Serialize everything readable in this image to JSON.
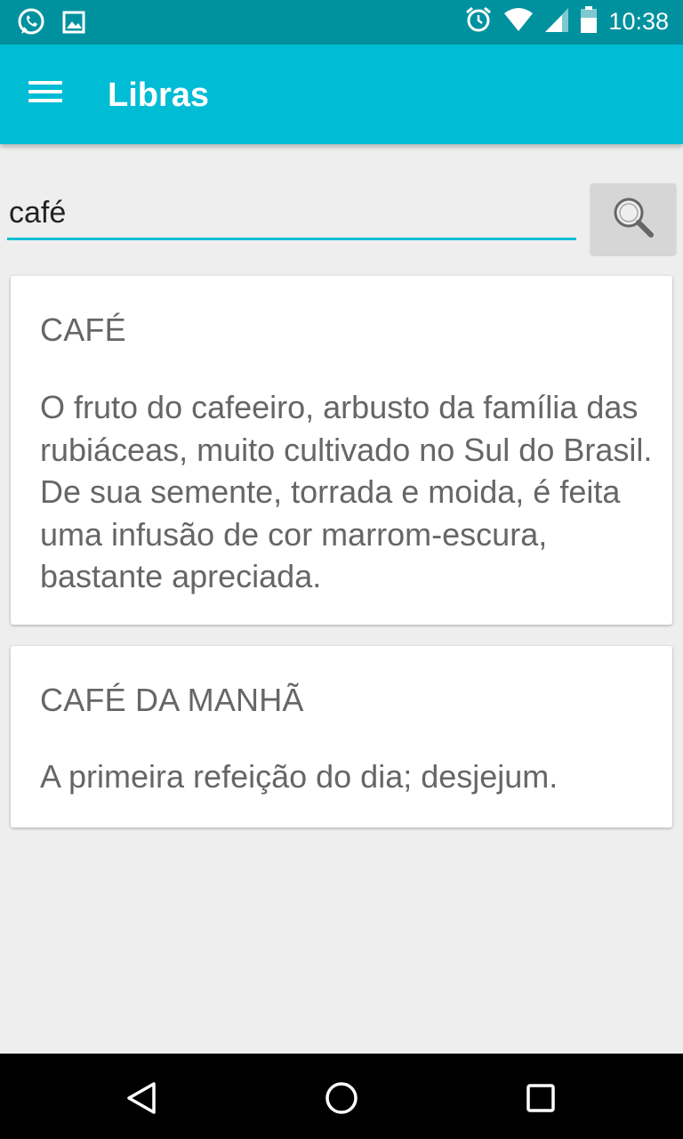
{
  "status_bar": {
    "time": "10:38",
    "left_icons": [
      "whatsapp-icon",
      "image-icon"
    ],
    "right_icons": [
      "alarm-icon",
      "wifi-icon",
      "signal-icon",
      "battery-icon"
    ]
  },
  "app_bar": {
    "title": "Libras",
    "menu_icon": "menu-icon"
  },
  "search": {
    "value": "café",
    "button_icon": "search-icon"
  },
  "results": [
    {
      "title": "CAFÉ",
      "definition": "O fruto do cafeeiro, arbusto da família das rubiáceas, muito cultivado no Sul do Brasil. De sua semente, torrada e moida, é feita uma infusão de cor marrom-escura, bastante apreciada."
    },
    {
      "title": "CAFÉ DA MANHÃ",
      "definition": "A primeira refeição do dia; desjejum."
    }
  ],
  "nav_bar": {
    "buttons": [
      "back-icon",
      "home-icon",
      "recents-icon"
    ]
  },
  "colors": {
    "status_bar": "#00919f",
    "app_bar": "#00bcd4",
    "accent": "#00bcd4",
    "background": "#eeeeee",
    "card_text": "#666666"
  }
}
